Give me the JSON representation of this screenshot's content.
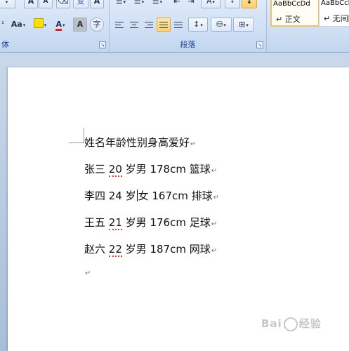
{
  "ribbon": {
    "font_group": {
      "label": "体",
      "font_size_label": "Aa"
    },
    "paragraph_group": {
      "label": "段落"
    },
    "styles": [
      {
        "sample": "AaBbCcDd",
        "name": "↵ 正文",
        "selected": true
      },
      {
        "sample": "AaBbCcI",
        "name": "↵ 无间隔",
        "selected": false
      }
    ],
    "launcher_glyph": "↘"
  },
  "document": {
    "lines": [
      {
        "text": "姓名年龄性别身高爱好"
      },
      {
        "name": "张三",
        "age": "20",
        "rest": "岁男 178cm 篮球"
      },
      {
        "pre": "李四 24 岁",
        "post": "女 167cm 排球"
      },
      {
        "name": "王五",
        "age": "21",
        "rest": "岁男 176cm 足球"
      },
      {
        "name": "赵六",
        "age": "22",
        "rest": "岁男 187cm 网球"
      }
    ],
    "paragraph_mark": "↵"
  },
  "watermark": {
    "left": "Bai",
    "right": "经验"
  },
  "colors": {
    "ribbon_bg": "#cfdff4",
    "active_button": "#ffcf6a",
    "highlight_yellow": "#ffe000",
    "font_red": "#e02020",
    "spell_error": "#e23a3a"
  }
}
